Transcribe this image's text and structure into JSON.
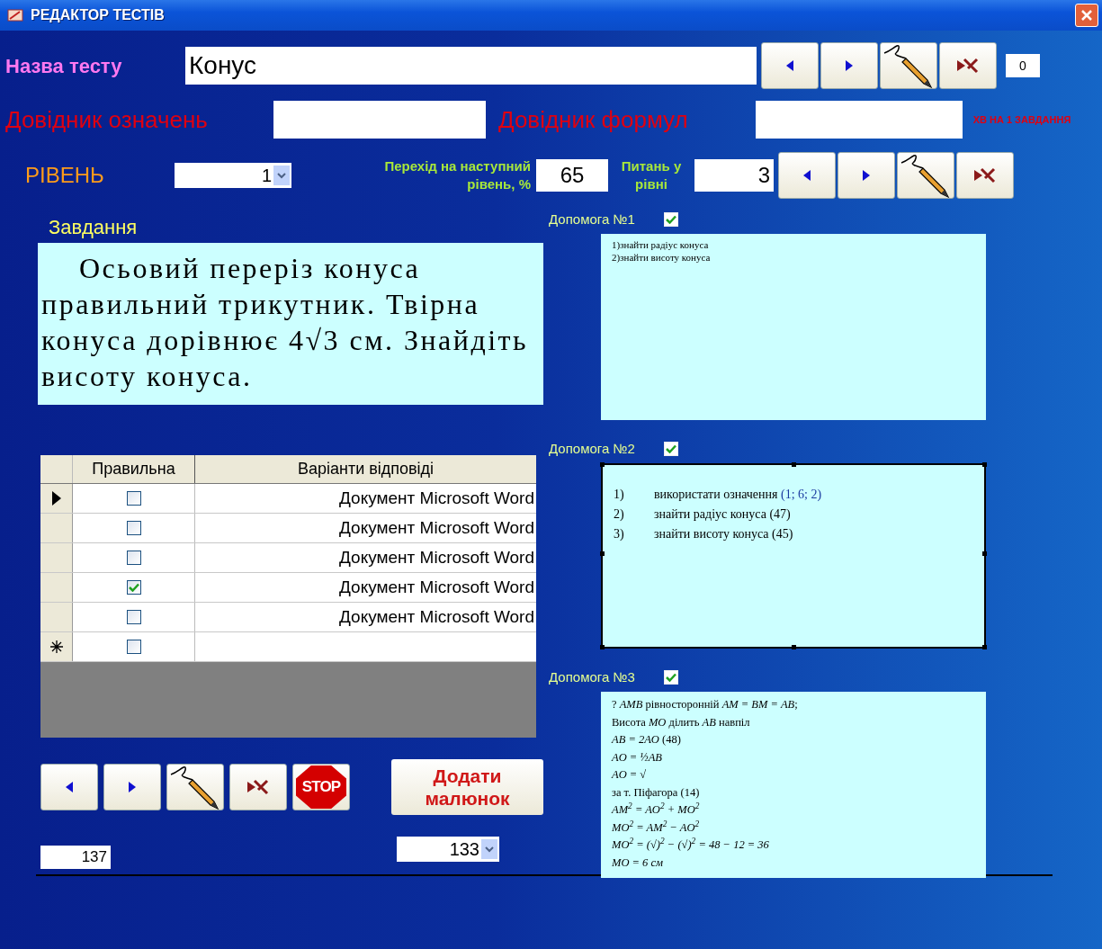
{
  "window": {
    "title": "РЕДАКТОР ТЕСТІВ"
  },
  "test_name": {
    "label": "Назва тесту",
    "value": "Конус"
  },
  "test_nav": [
    {
      "kind": "prev"
    },
    {
      "kind": "next"
    },
    {
      "kind": "edit"
    },
    {
      "kind": "delete"
    }
  ],
  "test_counter": "0",
  "definitions": {
    "label": "Довідник означень"
  },
  "formulas": {
    "label": "Довідник формул"
  },
  "minutes_note": "ХВ НА 1 ЗАВДАННЯ",
  "level": {
    "label": "РІВЕНЬ",
    "value": "1",
    "pass_label": "Перехід на наступний рівень, %",
    "pass_value": "65",
    "questions_label": "Питань у рівні",
    "questions_value": "3"
  },
  "level_nav": [
    {
      "kind": "prev"
    },
    {
      "kind": "next"
    },
    {
      "kind": "edit"
    },
    {
      "kind": "delete"
    }
  ],
  "task": {
    "label": "Завдання",
    "text": "Осьовий переріз конуса правильний трикутник. Твірна конуса дорівнює 4√3 см. Знайдіть висоту конуса."
  },
  "answers": {
    "columns": [
      "Правильна",
      "Варіанти відповіді"
    ],
    "rows": [
      {
        "kind": "record",
        "selected": true,
        "checked": false,
        "text": "Документ Microsoft Word"
      },
      {
        "kind": "record",
        "selected": false,
        "checked": false,
        "text": "Документ Microsoft Word"
      },
      {
        "kind": "record",
        "selected": false,
        "checked": false,
        "text": "Документ Microsoft Word"
      },
      {
        "kind": "record",
        "selected": false,
        "checked": true,
        "text": "Документ Microsoft Word"
      },
      {
        "kind": "record",
        "selected": false,
        "checked": false,
        "text": "Документ Microsoft Word"
      },
      {
        "kind": "new",
        "selected": false,
        "checked": false
      }
    ]
  },
  "bottom_nav": [
    {
      "kind": "prev"
    },
    {
      "kind": "next"
    },
    {
      "kind": "edit"
    },
    {
      "kind": "delete"
    },
    {
      "kind": "stop",
      "label": "STOP"
    }
  ],
  "add_picture": "Додати малюнок",
  "record_counter": "137",
  "picture_select": "133",
  "helps": [
    {
      "label": "Допомога №1",
      "checked": true,
      "kind": "plain",
      "lines": [
        {
          "text": "1)знайти радіус конуса"
        },
        {
          "text": "2)знайти висоту конуса"
        }
      ]
    },
    {
      "label": "Допомога №2",
      "checked": true,
      "kind": "numbered",
      "lines": [
        {
          "num": "1)",
          "text": "використати означення",
          "ref": "(1; 6; 2)"
        },
        {
          "num": "2)",
          "text": "знайти радіус конуса   (47)"
        },
        {
          "num": "3)",
          "text": "знайти висоту конуса   (45)"
        }
      ]
    },
    {
      "label": "Допомога №3",
      "checked": true,
      "kind": "plain",
      "lines": [
        {
          "text": "? *AMB* рівносторонній *AM = BM = AB*;"
        },
        {
          "text": "Висота *MO* ділить *AB* навпіл"
        },
        {
          "text": "*AB = 2AO* (48)"
        },
        {
          "text": "*AO = ½AB*"
        },
        {
          "text": "*AO = √*"
        },
        {
          "text": "за т. Піфагора (14)"
        },
        {
          "text": "*AM$^{2}$ = AO$^{2}$ + MO$^{2}$*"
        },
        {
          "text": "*MO$^{2}$ = AM$^{2}$ − AO$^{2}$*"
        },
        {
          "text": "*MO$^{2}$ = (√)$^{2}$ − (√)$^{2}$ = 48 − 12 = 36*"
        },
        {
          "text": "*MO = 6 см*"
        }
      ]
    }
  ]
}
